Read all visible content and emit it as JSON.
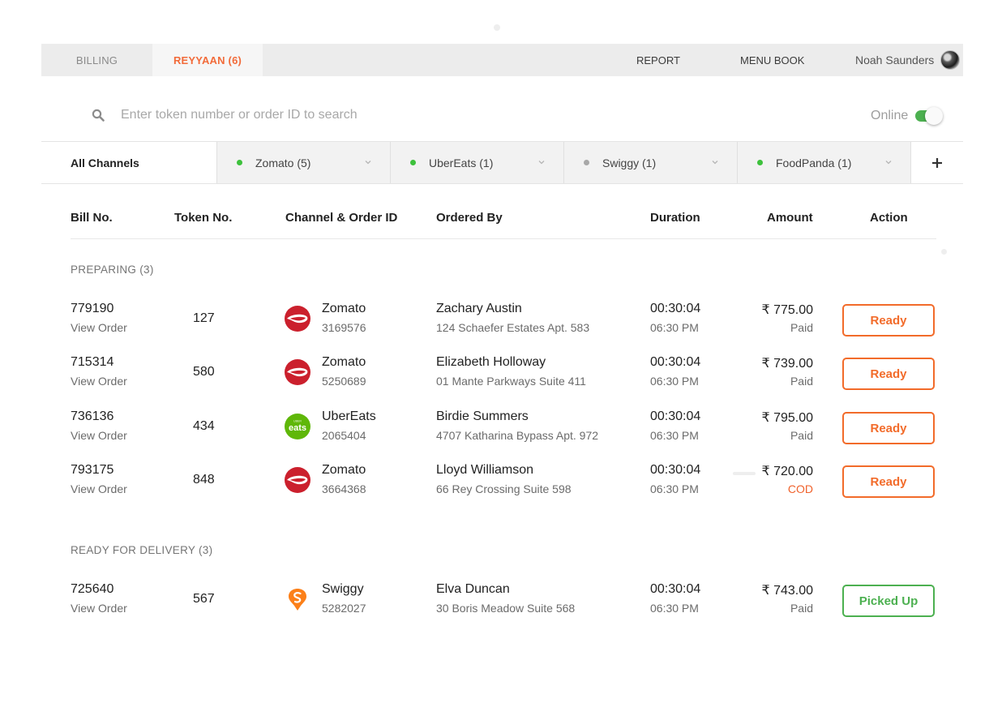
{
  "topnav": {
    "tabs": [
      {
        "label": "BILLING",
        "active": false
      },
      {
        "label": "REYYAAN (6)",
        "active": true
      }
    ],
    "links": [
      "REPORT",
      "MENU BOOK"
    ],
    "user_name": "Noah Saunders"
  },
  "search": {
    "placeholder": "Enter token number or order ID to search",
    "value": ""
  },
  "status": {
    "label": "Online",
    "online": true
  },
  "channels": {
    "all_label": "All Channels",
    "items": [
      {
        "label": "Zomato (5)",
        "status_color": "#3dc13c"
      },
      {
        "label": "UberEats (1)",
        "status_color": "#3dc13c"
      },
      {
        "label": "Swiggy (1)",
        "status_color": "#a8a8a8"
      },
      {
        "label": "FoodPanda (1)",
        "status_color": "#3dc13c"
      }
    ],
    "add_label": "+"
  },
  "table": {
    "columns": [
      "Bill No.",
      "Token No.",
      "Channel & Order ID",
      "Ordered By",
      "Duration",
      "Amount",
      "Action"
    ],
    "sections": [
      {
        "title": "PREPARING (3)",
        "rows": [
          {
            "bill": "779190",
            "view": "View Order",
            "token": "127",
            "channel": "Zomato",
            "channel_icon": "zomato-logo-icon",
            "order_id": "3169576",
            "customer": "Zachary Austin",
            "address": "124 Schaefer Estates Apt. 583",
            "duration": "00:30:04",
            "time": "06:30 PM",
            "amount": "₹ 775.00",
            "payment": "Paid",
            "action": "Ready"
          },
          {
            "bill": "715314",
            "view": "View Order",
            "token": "580",
            "channel": "Zomato",
            "channel_icon": "zomato-logo-icon",
            "order_id": "5250689",
            "customer": "Elizabeth Holloway",
            "address": "01 Mante Parkways Suite 411",
            "duration": "00:30:04",
            "time": "06:30 PM",
            "amount": "₹ 739.00",
            "payment": "Paid",
            "action": "Ready"
          },
          {
            "bill": "736136",
            "view": "View Order",
            "token": "434",
            "channel": "UberEats",
            "channel_icon": "ubereats-logo-icon",
            "order_id": "2065404",
            "customer": "Birdie Summers",
            "address": "4707 Katharina Bypass Apt. 972",
            "duration": "00:30:04",
            "time": "06:30 PM",
            "amount": "₹ 795.00",
            "payment": "Paid",
            "action": "Ready"
          },
          {
            "bill": "793175",
            "view": "View Order",
            "token": "848",
            "channel": "Zomato",
            "channel_icon": "zomato-logo-icon",
            "order_id": "3664368",
            "customer": "Lloyd Williamson",
            "address": "66 Rey Crossing Suite 598",
            "duration": "00:30:04",
            "time": "06:30 PM",
            "amount": "₹ 720.00",
            "payment": "COD",
            "action": "Ready"
          }
        ]
      },
      {
        "title": "READY FOR DELIVERY (3)",
        "rows": [
          {
            "bill": "725640",
            "view": "View Order",
            "token": "567",
            "channel": "Swiggy",
            "channel_icon": "swiggy-logo-icon",
            "order_id": "5282027",
            "customer": "Elva Duncan",
            "address": "30 Boris Meadow Suite 568",
            "duration": "00:30:04",
            "time": "06:30 PM",
            "amount": "₹ 743.00",
            "payment": "Paid",
            "action": "Picked Up"
          }
        ]
      }
    ]
  },
  "ubereats_logo_text": "eats",
  "colors": {
    "accent": "#f26b2a",
    "success": "#4cb050",
    "zomato": "#cb202d",
    "ubereats": "#5fb709",
    "swiggy": "#fc8019"
  }
}
